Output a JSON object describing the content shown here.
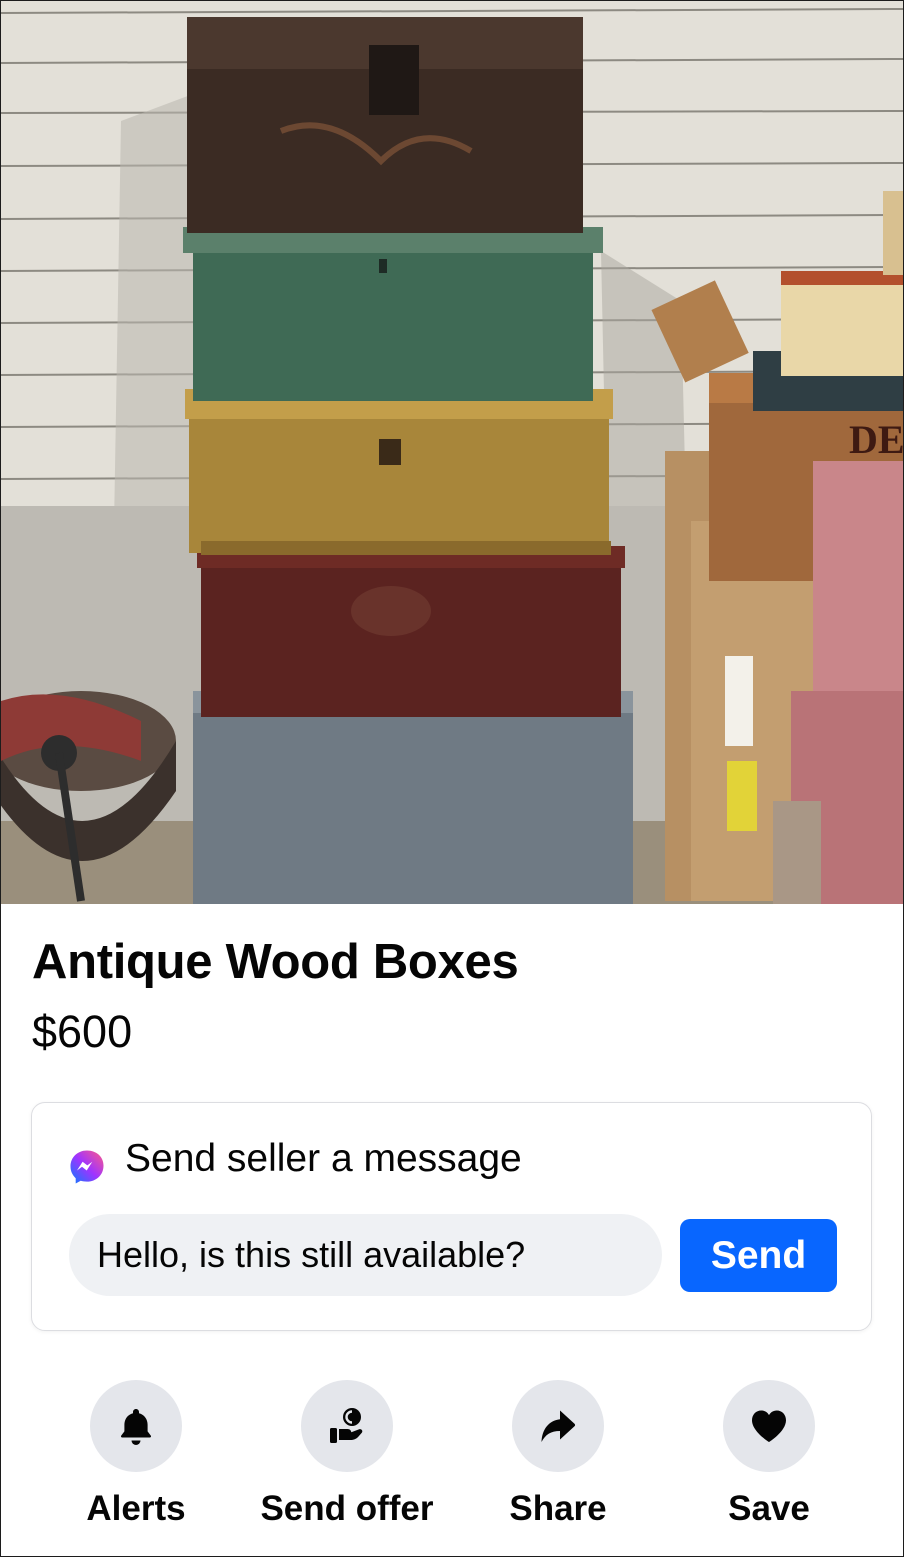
{
  "listing": {
    "title": "Antique Wood Boxes",
    "price": "$600",
    "photo_alt": "Antique Wood Boxes"
  },
  "message": {
    "heading": "Send seller a message",
    "input_value": "Hello, is this still available?",
    "send_label": "Send",
    "icon": "messenger-icon"
  },
  "actions": [
    {
      "label": "Alerts",
      "icon": "bell-icon"
    },
    {
      "label": "Send offer",
      "icon": "offer-icon"
    },
    {
      "label": "Share",
      "icon": "share-arrow-icon"
    },
    {
      "label": "Save",
      "icon": "heart-icon"
    }
  ],
  "colors": {
    "accent": "#0866ff",
    "action_circle": "#e4e6eb",
    "input_bg": "#eff1f4",
    "text": "#050505"
  }
}
